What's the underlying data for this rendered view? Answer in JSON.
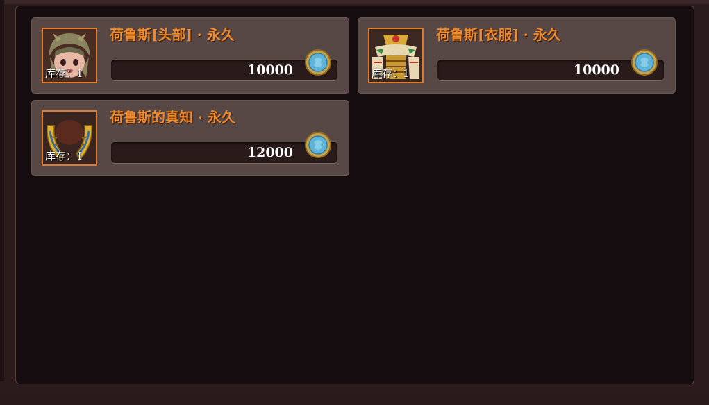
{
  "currency": {
    "icon": "blue-gem-coin-icon",
    "colors": {
      "outer": "#c9a24a",
      "inner": "#5fb3d6"
    }
  },
  "items": [
    {
      "name": "荷鲁斯[头部] · 永久",
      "stock": "库存：1",
      "price": "10000",
      "icon": "horus-head-icon"
    },
    {
      "name": "荷鲁斯[衣服] · 永久",
      "stock": "库存：1",
      "price": "10000",
      "icon": "horus-clothes-icon"
    },
    {
      "name": "荷鲁斯的真知 · 永久",
      "stock": "库存：1",
      "price": "12000",
      "icon": "horus-wings-icon"
    }
  ],
  "colors": {
    "title": "#f08a2a",
    "card": "#574745",
    "panel": "#150d0f",
    "icon_border": "#e07a2c"
  }
}
